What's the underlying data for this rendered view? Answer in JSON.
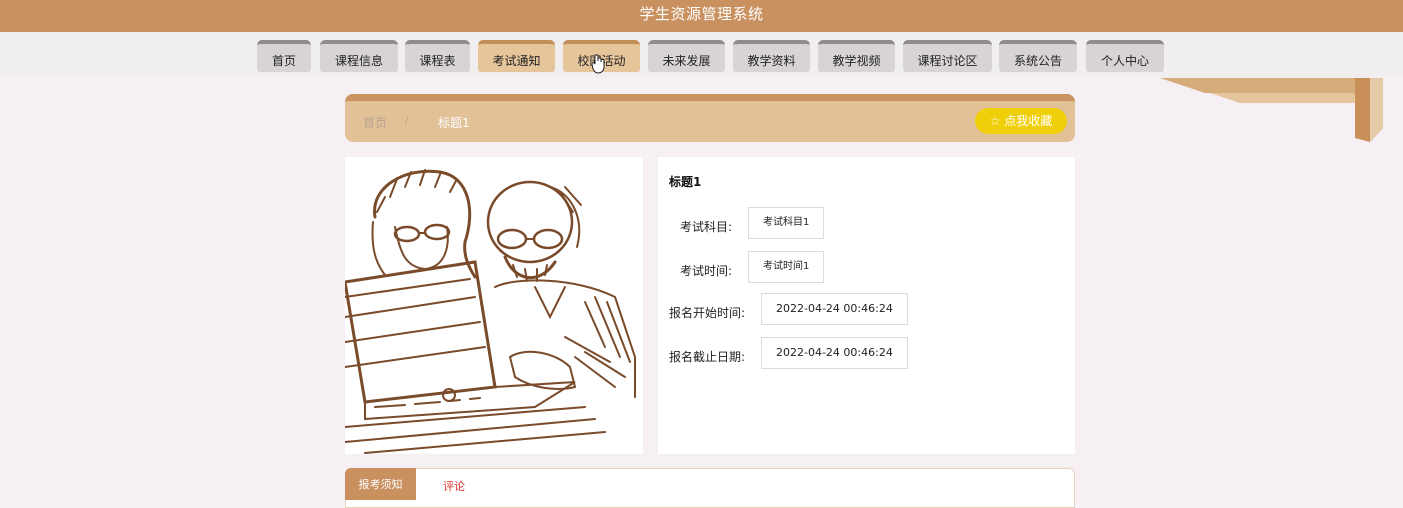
{
  "app": {
    "title": "学生资源管理系统"
  },
  "nav": {
    "items": [
      {
        "label": "首页",
        "active": false
      },
      {
        "label": "课程信息",
        "active": false
      },
      {
        "label": "课程表",
        "active": false
      },
      {
        "label": "考试通知",
        "active": true
      },
      {
        "label": "校园活动",
        "active": true
      },
      {
        "label": "未来发展",
        "active": false
      },
      {
        "label": "教学资料",
        "active": false
      },
      {
        "label": "教学视频",
        "active": false
      },
      {
        "label": "课程讨论区",
        "active": false
      },
      {
        "label": "系统公告",
        "active": false
      },
      {
        "label": "个人中心",
        "active": false
      }
    ]
  },
  "breadcrumb": {
    "home": "首页",
    "separator": "/",
    "current": "标题1"
  },
  "favorite": {
    "icon": "star-outline-icon",
    "label": "☆ 点我收藏"
  },
  "detail": {
    "title": "标题1",
    "fields": [
      {
        "label": "考试科目:",
        "value": "考试科目1"
      },
      {
        "label": "考试时间:",
        "value": "考试时间1"
      },
      {
        "label": "报名开始时间:",
        "value": "2022-04-24 00:46:24"
      },
      {
        "label": "报名截止日期:",
        "value": "2022-04-24 00:46:24"
      }
    ]
  },
  "tabs": [
    {
      "label": "报考须知",
      "active": true
    },
    {
      "label": "评论",
      "active": false
    }
  ],
  "colors": {
    "header": "#c99060",
    "nav_inactive": "#d7d3d6",
    "nav_active": "#e6c59b",
    "favorite": "#efcf0a",
    "comment_tab_text": "#e0312a"
  }
}
